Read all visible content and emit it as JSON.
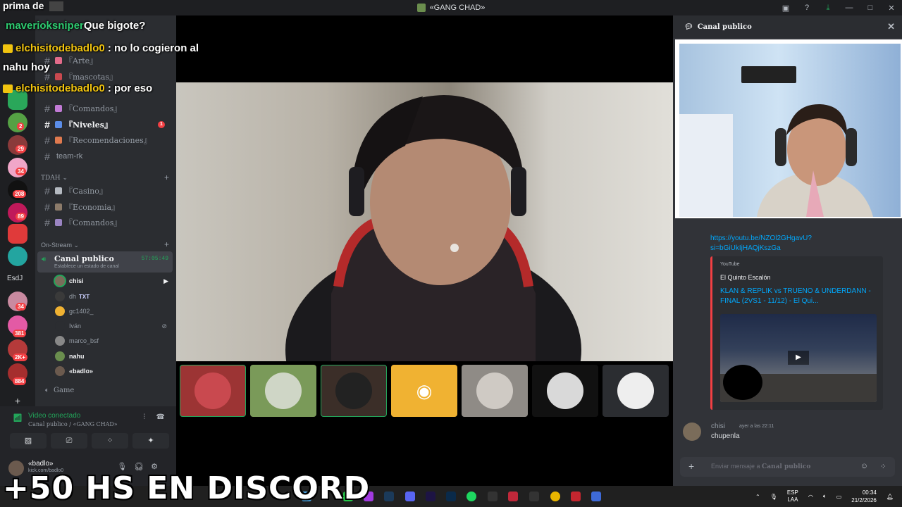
{
  "window": {
    "title": "«GANG CHAD»"
  },
  "overlay": {
    "top_caption": "prima de",
    "chat": [
      {
        "user": "maverioksniper",
        "text": "Que bigote?"
      },
      {
        "user": "elchisitodebadlo0",
        "text": ": no lo cogieron al"
      },
      {
        "user": "",
        "text": "nahu hoy"
      },
      {
        "user": "elchisitodebadlo0",
        "text": ": por eso"
      }
    ],
    "big_caption": "+50 HS EN DISCORD"
  },
  "rail": {
    "badges": [
      "2",
      "29",
      "34",
      "208",
      "89",
      "34",
      "381",
      "2K+",
      "884"
    ],
    "folder_label": "EsdJ"
  },
  "channels": {
    "list": [
      {
        "name": "『Arte』"
      },
      {
        "name": "『mascotas』"
      },
      {
        "name": "『Comandos』"
      },
      {
        "name": "『Niveles』",
        "unread": "1"
      },
      {
        "name": "『Recomendaciones』"
      },
      {
        "name": "team-rk"
      }
    ],
    "category_tdah": "TDAH",
    "tdah_list": [
      {
        "name": "『Casino』"
      },
      {
        "name": "『Economia』"
      },
      {
        "name": "『Comandos』"
      }
    ],
    "category_stream": "On-Stream",
    "voice": {
      "name": "Canal publico",
      "status": "Establece un estado de canal",
      "timer": "57:05:49"
    },
    "voice_users": [
      {
        "name": "chisi",
        "speaking": true
      },
      {
        "name": "dh",
        "badge": "TXT"
      },
      {
        "name": "gc1402_"
      },
      {
        "name": "Iván"
      },
      {
        "name": "marco_bsf"
      },
      {
        "name": "nahu",
        "speaking": true
      },
      {
        "name": "«badlo»",
        "speaking": true
      }
    ],
    "game_channel": "Game"
  },
  "voice_panel": {
    "status": "Video conectado",
    "location": "Canal publico / «GANG CHAD»"
  },
  "user_panel": {
    "name": "«badlo»",
    "sub": "kick.com/badlo0"
  },
  "right_panel": {
    "title": "Canal publico",
    "link_lines": [
      "https://youtu.be/NZOl2GHgavU?",
      "si=bGiUkIjHAQjKszGa"
    ],
    "embed": {
      "source": "YouTube",
      "author": "El Quinto Escalón",
      "title": "KLAN & REPLIK vs TRUENO & UNDERDANN - FINAL (2VS1 - 11/12) - El Qui..."
    },
    "message": {
      "author": "chisi",
      "time": "ayer a las 22:11",
      "text": "chupenla"
    },
    "composer_placeholder_prefix": "Enviar mensaje a ",
    "composer_placeholder_channel": "Canal publico"
  },
  "taskbar": {
    "lang": "ESP",
    "region": "LAA",
    "time": "00:34",
    "date": "21/2/2026"
  },
  "colors": {
    "accent_green": "#23a55a",
    "link": "#00a8fc",
    "badge_red": "#f23f43",
    "discord_blurple": "#5865f2",
    "discord_tile_orange": "#f0b232"
  }
}
